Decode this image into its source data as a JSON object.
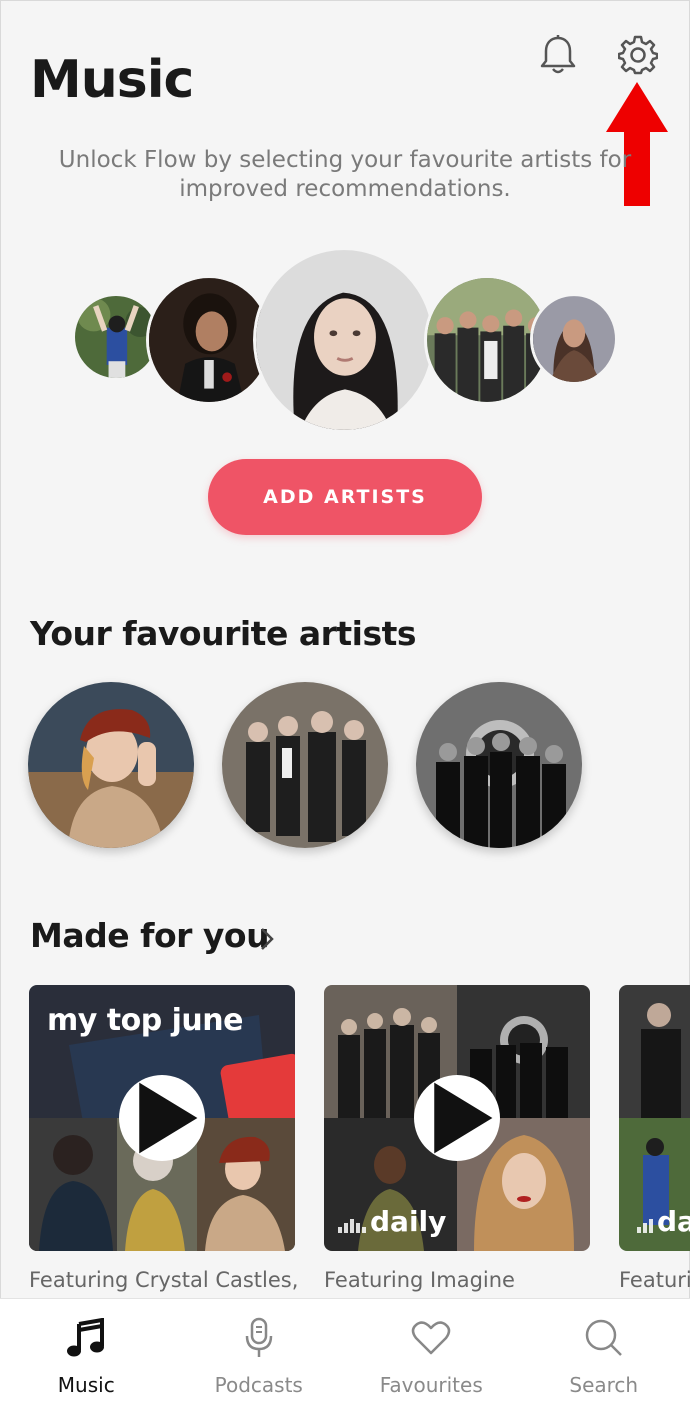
{
  "header": {
    "title": "Music"
  },
  "promo": {
    "text": "Unlock Flow by selecting your favourite artists for improved recommendations.",
    "button_label": "ADD ARTISTS"
  },
  "favourites": {
    "title": "Your favourite artists"
  },
  "made_for_you": {
    "title": "Made for you",
    "cards": [
      {
        "label": "my top june",
        "caption": "Featuring Crystal Castles,"
      },
      {
        "label": "daily",
        "caption": "Featuring Imagine"
      },
      {
        "label": "da",
        "caption": "Featuri"
      }
    ]
  },
  "bottom_nav": {
    "items": [
      {
        "label": "Music",
        "icon": "music-note-icon",
        "active": true
      },
      {
        "label": "Podcasts",
        "icon": "microphone-icon"
      },
      {
        "label": "Favourites",
        "icon": "heart-icon"
      },
      {
        "label": "Search",
        "icon": "search-icon"
      }
    ]
  },
  "colors": {
    "accent": "#ef5466",
    "annotation_arrow": "#ee0000",
    "background": "#f5f5f5"
  }
}
